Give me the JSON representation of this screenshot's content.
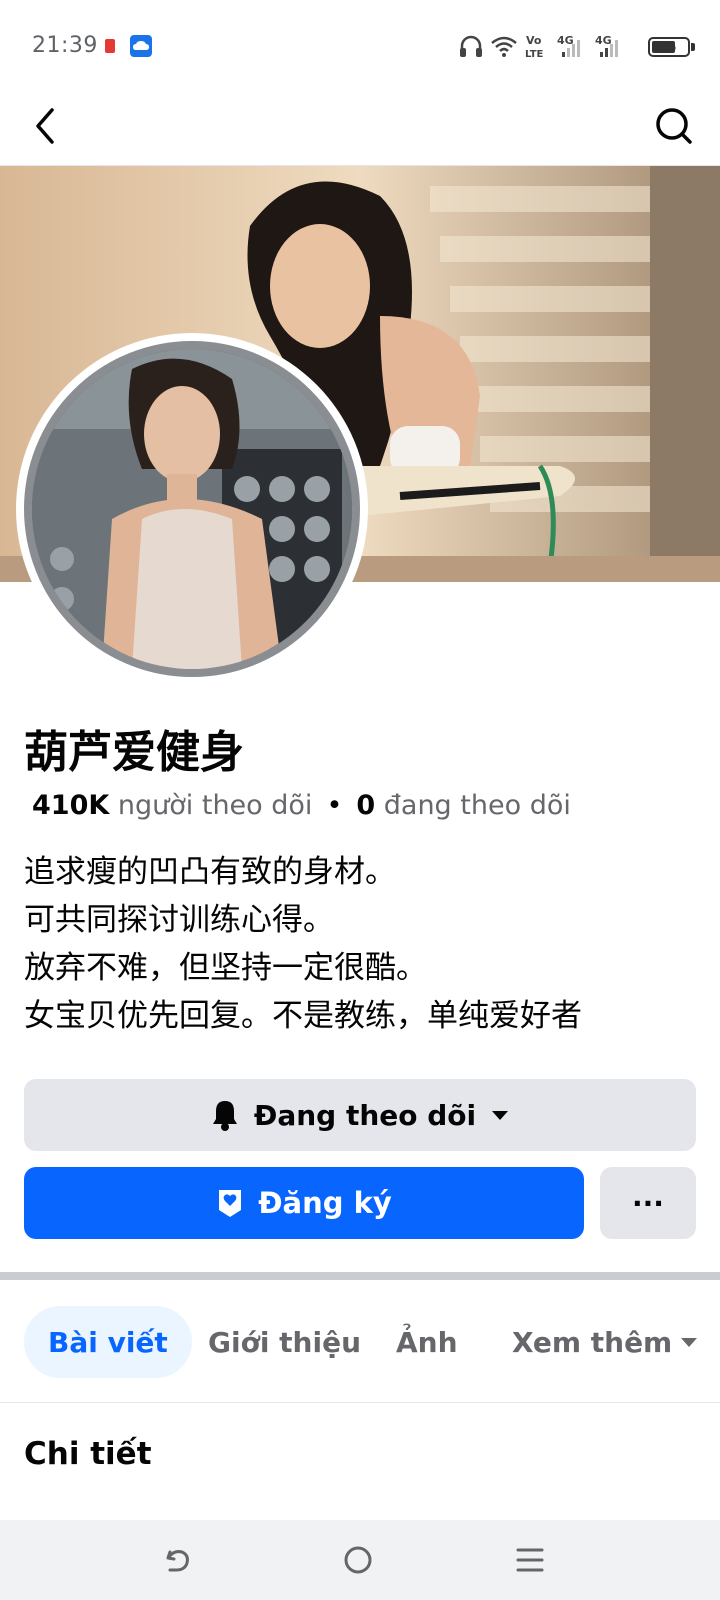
{
  "status_bar": {
    "time": "21:39",
    "battery": "65",
    "network_labels": [
      "Vo LTE",
      "4G",
      "4G"
    ]
  },
  "profile": {
    "name": "葫芦爱健身",
    "followers_count": "410K",
    "followers_label": "người theo dõi",
    "following_count": "0",
    "following_label": "đang theo dõi",
    "bio_lines": [
      "追求瘦的凹凸有致的身材。",
      "可共同探讨训练心得。",
      "放弃不难，但坚持一定很酷。",
      "女宝贝优先回复。不是教练，单纯爱好者"
    ]
  },
  "actions": {
    "following_label": "Đang theo dõi",
    "subscribe_label": "Đăng ký",
    "more_label": "···"
  },
  "tabs": [
    {
      "label": "Bài viết",
      "active": true
    },
    {
      "label": "Giới thiệu",
      "active": false
    },
    {
      "label": "Ảnh",
      "active": false
    },
    {
      "label": "Xem thêm",
      "active": false
    }
  ],
  "section": {
    "title": "Chi tiết"
  },
  "colors": {
    "accent": "#0866ff",
    "button_gray": "#e4e6eb",
    "tab_active_bg": "#ebf5ff",
    "secondary_text": "#65676b"
  },
  "icons": {
    "back": "chevron-left-icon",
    "search": "search-icon",
    "bell": "bell-icon",
    "caret": "caret-down-icon",
    "badge": "subscription-badge-icon",
    "nav_back": "nav-back-icon",
    "nav_home": "nav-home-icon",
    "nav_menu": "nav-menu-icon"
  }
}
